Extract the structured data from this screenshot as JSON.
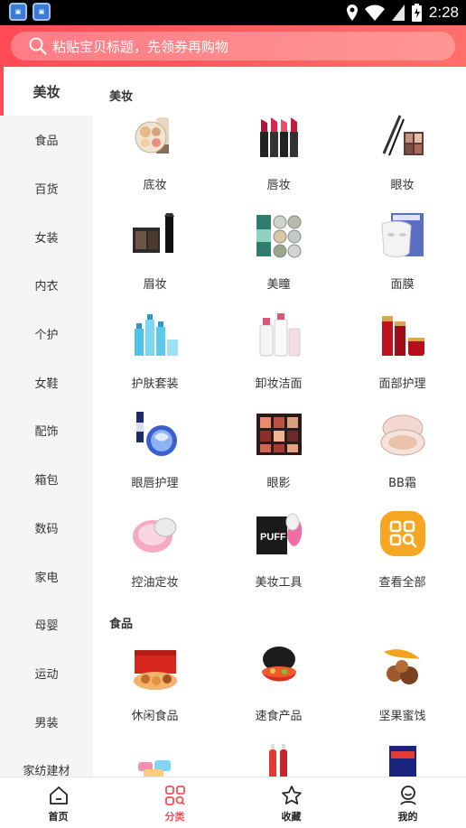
{
  "status_bar": {
    "time": "2:28",
    "app_icons": [
      "app-icon",
      "app-icon"
    ]
  },
  "search": {
    "placeholder": "粘贴宝贝标题，先领券再购物"
  },
  "sidebar": {
    "items": [
      {
        "label": "美妆",
        "active": true
      },
      {
        "label": "食品"
      },
      {
        "label": "百货"
      },
      {
        "label": "女装"
      },
      {
        "label": "内衣"
      },
      {
        "label": "个护"
      },
      {
        "label": "女鞋"
      },
      {
        "label": "配饰"
      },
      {
        "label": "箱包"
      },
      {
        "label": "数码"
      },
      {
        "label": "家电"
      },
      {
        "label": "母婴"
      },
      {
        "label": "运动"
      },
      {
        "label": "男装"
      },
      {
        "label": "家纺建材"
      }
    ]
  },
  "sections": [
    {
      "title": "美妆",
      "items": [
        {
          "label": "底妆",
          "icon": "foundation-palette"
        },
        {
          "label": "唇妆",
          "icon": "lipsticks"
        },
        {
          "label": "眼妆",
          "icon": "eye-makeup-set"
        },
        {
          "label": "眉妆",
          "icon": "eyebrow-kit"
        },
        {
          "label": "美瞳",
          "icon": "color-contacts"
        },
        {
          "label": "面膜",
          "icon": "face-mask"
        },
        {
          "label": "护肤套装",
          "icon": "skincare-bottles"
        },
        {
          "label": "卸妆洁面",
          "icon": "cleanser-bottles"
        },
        {
          "label": "面部护理",
          "icon": "red-skincare-set"
        },
        {
          "label": "眼唇护理",
          "icon": "eye-patch-serum"
        },
        {
          "label": "眼影",
          "icon": "eyeshadow-palette"
        },
        {
          "label": "BB霜",
          "icon": "cushion-compact"
        },
        {
          "label": "控油定妆",
          "icon": "pink-powder"
        },
        {
          "label": "美妆工具",
          "icon": "puff-sponge"
        },
        {
          "label": "查看全部",
          "icon": "view-all-icon"
        }
      ]
    },
    {
      "title": "食品",
      "items": [
        {
          "label": "休闲食品",
          "icon": "snack-gift-box"
        },
        {
          "label": "速食产品",
          "icon": "hotpot-bowl"
        },
        {
          "label": "坚果蜜饯",
          "icon": "nuts-mango"
        },
        {
          "label": "",
          "icon": "candy-snacks"
        },
        {
          "label": "",
          "icon": "bottled-drinks"
        },
        {
          "label": "",
          "icon": "imported-snack"
        }
      ]
    }
  ],
  "tabbar": {
    "tabs": [
      {
        "label": "首页",
        "icon": "home-icon"
      },
      {
        "label": "分类",
        "icon": "category-icon",
        "active": true
      },
      {
        "label": "收藏",
        "icon": "star-icon"
      },
      {
        "label": "我的",
        "icon": "profile-icon"
      }
    ]
  },
  "colors": {
    "accent": "#ff4a57",
    "header_start": "#ff4a57",
    "header_end": "#ff6f6a",
    "view_all": "#f5a623"
  }
}
